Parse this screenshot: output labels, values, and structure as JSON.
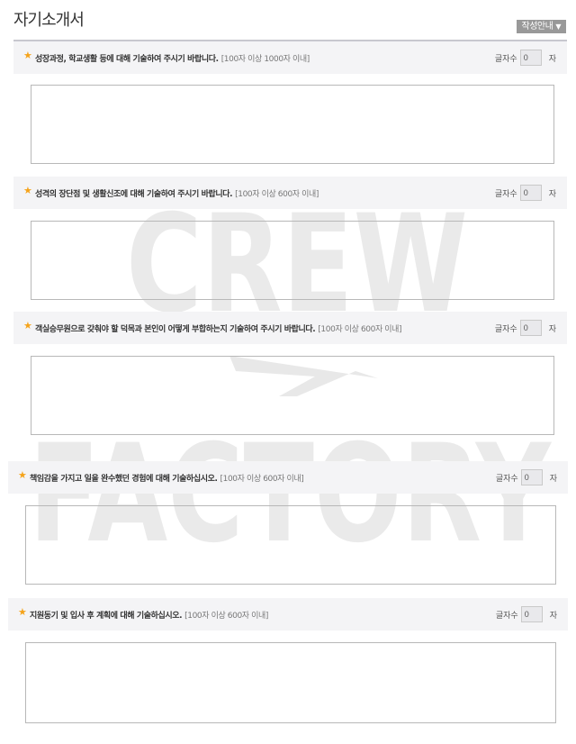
{
  "page": {
    "title": "자기소개서",
    "guide_button": "작성안내",
    "watermark": [
      "CREW",
      "FACTORY"
    ]
  },
  "counter_label": "글자수",
  "counter_unit": "자",
  "questions": [
    {
      "text": "성장과정, 학교생활 등에 대해 기술하여 주시기 바랍니다.",
      "limit": "[100자 이상 1000자 이내]",
      "count": "0"
    },
    {
      "text": "성격의 장단점 및 생활신조에 대해 기술하여 주시기 바랍니다.",
      "limit": "[100자 이상 600자 이내]",
      "count": "0"
    },
    {
      "text": "객실승무원으로 갖춰야 할 덕목과 본인이 어떻게 부합하는지 기술하여 주시기 바랍니다.",
      "limit": "[100자 이상 600자 이내]",
      "count": "0"
    },
    {
      "text": "책임감을 가지고 일을 완수했던 경험에 대해 기술하십시오.",
      "limit": "[100자 이상 600자 이내]",
      "count": "0"
    },
    {
      "text": "지원동기 및 입사 후 계획에 대해 기술하십시오.",
      "limit": "[100자 이상 600자 이내]",
      "count": "0"
    }
  ]
}
